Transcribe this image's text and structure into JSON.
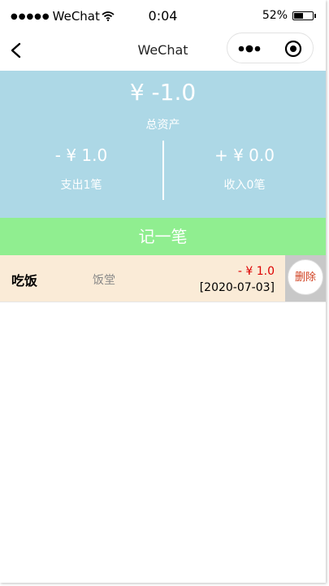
{
  "status_bar": {
    "carrier": "WeChat",
    "time": "0:04",
    "battery_percent": "52%",
    "battery_level": 0.52
  },
  "nav": {
    "title": "WeChat"
  },
  "summary": {
    "total_amount": "¥ -1.0",
    "total_label": "总资产",
    "expense_amount": "- ¥ 1.0",
    "expense_label": "支出1笔",
    "income_amount": "+ ¥ 0.0",
    "income_label": "收入0笔"
  },
  "add_button_label": "记一笔",
  "records": [
    {
      "title": "吃饭",
      "place": "饭堂",
      "amount": "- ¥  1.0",
      "date": "[2020-07-03]",
      "delete_label": "删除"
    }
  ],
  "colors": {
    "summary_bg": "#add8e6",
    "add_button_bg": "#90ee90",
    "record_bg": "#faebd7",
    "amount_red": "#dd0000"
  }
}
